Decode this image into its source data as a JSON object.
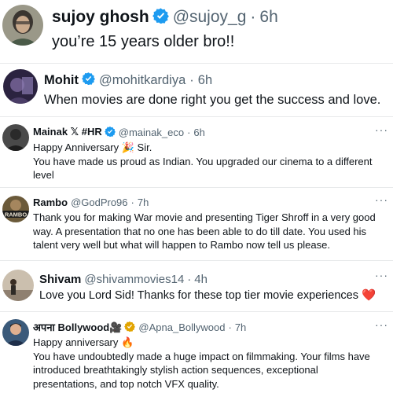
{
  "tweets": [
    {
      "name": "sujoy ghosh",
      "handle": "@sujoy_g",
      "time": "6h",
      "verified": true,
      "verified_color": "#1d9bf0",
      "lines": [
        "you’re 15 years older bro!!"
      ]
    },
    {
      "name": "Mohit",
      "handle": "@mohitkardiya",
      "time": "6h",
      "verified": true,
      "verified_color": "#1d9bf0",
      "lines": [
        "When movies are done right you get the success and love."
      ]
    },
    {
      "name": "Mainak 𝕏 #HR",
      "handle": "@mainak_eco",
      "time": "6h",
      "verified": true,
      "verified_color": "#1d9bf0",
      "more": "···",
      "lines": [
        "Happy Anniversary 🎉 Sir.",
        "You have made us proud as Indian. You upgraded our cinema to a different",
        "level"
      ]
    },
    {
      "name": "Rambo",
      "handle": "@GodPro96",
      "time": "7h",
      "verified": false,
      "more": "···",
      "avatar_text": "RAMBO",
      "lines": [
        "Thank you for making War movie and presenting Tiger Shroff in a very good",
        "way. A presentation that no one has been able to do till date. You used his",
        "talent very well but what will happen to Rambo now tell us please."
      ]
    },
    {
      "name": "Shivam",
      "handle": "@shivammovies14",
      "time": "4h",
      "verified": false,
      "more": "···",
      "lines": [
        "Love you Lord Sid! Thanks for these top tier movie experiences ❤️"
      ]
    },
    {
      "name": "अपना Bollywood🎥",
      "handle": "@Apna_Bollywood",
      "time": "7h",
      "verified": true,
      "verified_color": "#e2a400",
      "more": "···",
      "lines": [
        "Happy anniversary 🔥",
        "You have undoubtedly made a huge impact on filmmaking. Your films have",
        "introduced breathtakingly stylish action sequences, exceptional",
        "presentations, and top notch VFX quality."
      ]
    }
  ]
}
